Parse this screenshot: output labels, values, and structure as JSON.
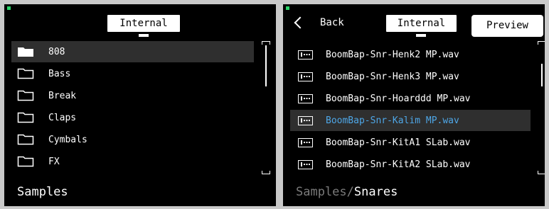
{
  "left": {
    "storage_tab": "Internal",
    "folders": [
      {
        "label": "808",
        "selected": true
      },
      {
        "label": "Bass",
        "selected": false
      },
      {
        "label": "Break",
        "selected": false
      },
      {
        "label": "Claps",
        "selected": false
      },
      {
        "label": "Cymbals",
        "selected": false
      },
      {
        "label": "FX",
        "selected": false
      }
    ],
    "footer": "Samples",
    "folder_icon": "folder-icon"
  },
  "right": {
    "back_label": "Back",
    "storage_tab": "Internal",
    "preview_label": "Preview",
    "files": [
      {
        "label": "BoomBap-Snr-Henk2 MP.wav",
        "selected": false
      },
      {
        "label": "BoomBap-Snr-Henk3 MP.wav",
        "selected": false
      },
      {
        "label": "BoomBap-Snr-Hoarddd MP.wav",
        "selected": false
      },
      {
        "label": "BoomBap-Snr-Kalim MP.wav",
        "selected": true
      },
      {
        "label": "BoomBap-Snr-KitA1 SLab.wav",
        "selected": false
      },
      {
        "label": "BoomBap-Snr-KitA2 SLab.wav",
        "selected": false
      }
    ],
    "footer_parent": "Samples/",
    "footer_current": "Snares",
    "file_icon": "waveform-file-icon"
  },
  "colors": {
    "background": "#000000",
    "selection": "#2f2f2f",
    "selected_text": "#4ea6e6",
    "status_led": "#2bd46a"
  }
}
